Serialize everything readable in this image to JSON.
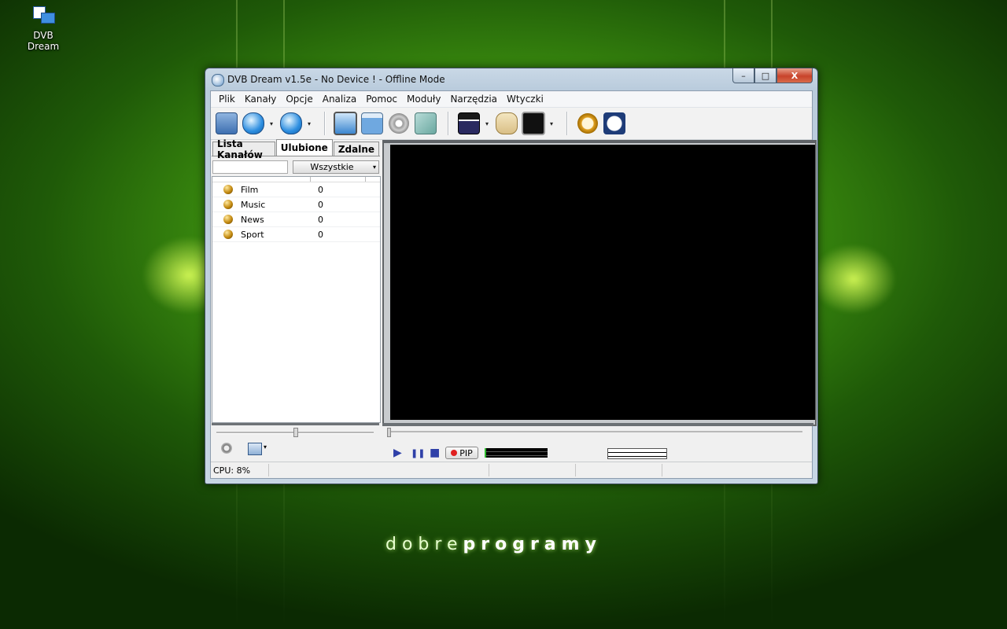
{
  "desktop": {
    "icon_label": "DVB Dream",
    "brand_light": "dobre",
    "brand_bold": "programy"
  },
  "window": {
    "title": "DVB Dream v1.5e - No Device ! - Offline Mode",
    "min_glyph": "–",
    "max_glyph": "□",
    "close_glyph": "X"
  },
  "menu": [
    "Plik",
    "Kanały",
    "Opcje",
    "Analiza",
    "Pomoc",
    "Moduły",
    "Narzędzia",
    "Wtyczki"
  ],
  "toolbar": {
    "icons": [
      "open-folder-icon",
      "back-icon",
      "forward-icon",
      "display-icon",
      "window-icon",
      "settings-gears-icon",
      "capture-icon",
      "clapperboard-icon",
      "scroll-icon",
      "record-monitor-icon",
      "stopwatch-icon",
      "schedule-clock-icon"
    ],
    "drop_glyph": "▾"
  },
  "left_panel": {
    "tabs": [
      "Lista Kanałów",
      "Ulubione",
      "Zdalne"
    ],
    "active_tab": "Ulubione",
    "filter": {
      "selected": "Wszystkie",
      "arrow": "▾"
    },
    "favorites": [
      {
        "name": "Film",
        "count": "0"
      },
      {
        "name": "Music",
        "count": "0"
      },
      {
        "name": "News",
        "count": "0"
      },
      {
        "name": "Sport",
        "count": "0"
      }
    ]
  },
  "playback": {
    "play": "▶",
    "pause": "❚❚",
    "stop": "■",
    "pip_label": "PIP"
  },
  "status": {
    "cpu": "CPU: 8%"
  },
  "colors": {
    "accent_green": "#6fc21a",
    "video_bg": "#000000",
    "close_red": "#c8432b"
  }
}
